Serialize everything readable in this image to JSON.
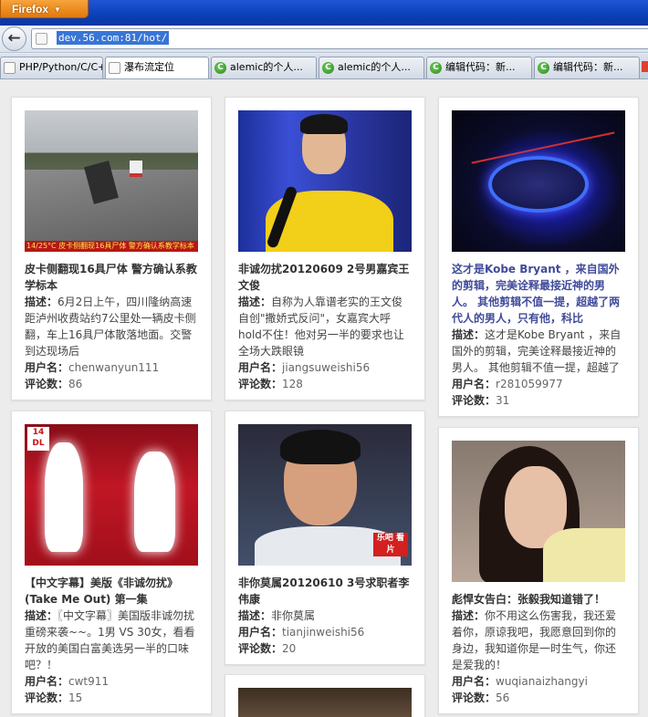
{
  "browser": {
    "menu_button_label": "Firefox",
    "menu_button_caret": "▼",
    "back_glyph": "←",
    "url": "dev.56.com:81/hot/",
    "tabs": [
      {
        "label": "PHP/Python/C/C++...",
        "icon": "page-icon",
        "active": false
      },
      {
        "label": "瀑布流定位",
        "icon": "page-icon",
        "active": true
      },
      {
        "label": "alemic的个人...",
        "icon": "site-c-icon",
        "active": false
      },
      {
        "label": "alemic的个人...",
        "icon": "site-c-icon",
        "active": false
      },
      {
        "label": "编辑代码：新...",
        "icon": "site-c-icon",
        "active": false
      },
      {
        "label": "编辑代码：新...",
        "icon": "site-c-icon",
        "active": false
      }
    ],
    "tab_icon_glyph": "C"
  },
  "labels": {
    "desc": "描述：",
    "user": "用户名：",
    "comments": "评论数："
  },
  "cards": [
    {
      "title": "皮卡侧翻现16具尸体 警方确认系教学标本",
      "desc": "6月2日上午，四川隆纳高速距泸州收费站约7公里处一辆皮卡侧翻，车上16具尸体散落地面。交警到达现场后",
      "user": "chenwanyun111",
      "comments": "86",
      "ticker": "14/25°C 皮卡侧翻现16具尸体 警方确认系教学标本",
      "title_style": "plain"
    },
    {
      "title": "非诚勿扰20120609 2号男嘉宾王文俊",
      "desc": "自称为人靠谱老实的王文俊自创\"撒娇式反问\"，女嘉宾大呼hold不住！他对另一半的要求也让全场大跌眼镜",
      "user": "jiangsuweishi56",
      "comments": "128",
      "title_style": "plain"
    },
    {
      "title": "这才是Kobe Bryant ，来自国外的剪辑，完美诠释最接近神的男人。 其他剪辑不值一提，超越了两代人的男人，只有他，科比",
      "desc": "这才是Kobe Bryant ，来自国外的剪辑，完美诠释最接近神的男人。 其他剪辑不值一提，超越了",
      "user": "r281059977",
      "comments": "31",
      "title_style": "link"
    },
    {
      "title": "【中文字幕】美版《非诚勿扰》(Take Me Out) 第一集",
      "desc": "〖中文字幕〗美国版非诚勿扰重磅来袭~~。1男 VS 30女，看看开放的美国白富美选另一半的口味吧？！",
      "user": "cwt911",
      "comments": "15",
      "logo": "14 DL",
      "title_style": "plain"
    },
    {
      "title": "非你莫属20120610 3号求职者李伟康",
      "desc": "非你莫属",
      "user": "tianjinweishi56",
      "comments": "20",
      "badge": "乐吧 看片",
      "title_style": "plain"
    },
    {
      "title": "彪悍女告白：张毅我知道错了！",
      "desc": "你不用这么伤害我，我还爱着你，原谅我吧，我愿意回到你的身边，我知道你是一时生气，你还是爱我的！",
      "user": "wuqianaizhangyi",
      "comments": "56",
      "title_style": "plain"
    }
  ]
}
